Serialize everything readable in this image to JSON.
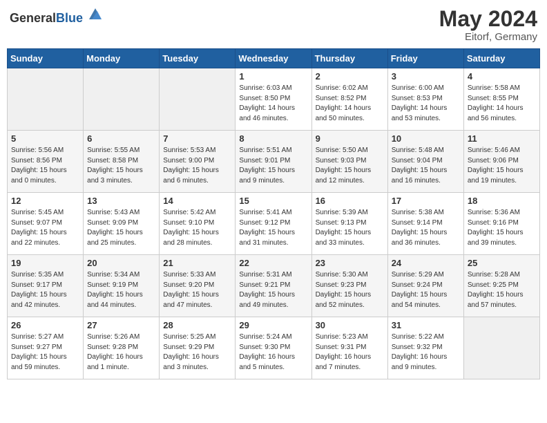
{
  "header": {
    "logo_general": "General",
    "logo_blue": "Blue",
    "month_year": "May 2024",
    "location": "Eitorf, Germany"
  },
  "weekdays": [
    "Sunday",
    "Monday",
    "Tuesday",
    "Wednesday",
    "Thursday",
    "Friday",
    "Saturday"
  ],
  "weeks": [
    [
      {
        "day": "",
        "info": ""
      },
      {
        "day": "",
        "info": ""
      },
      {
        "day": "",
        "info": ""
      },
      {
        "day": "1",
        "info": "Sunrise: 6:03 AM\nSunset: 8:50 PM\nDaylight: 14 hours\nand 46 minutes."
      },
      {
        "day": "2",
        "info": "Sunrise: 6:02 AM\nSunset: 8:52 PM\nDaylight: 14 hours\nand 50 minutes."
      },
      {
        "day": "3",
        "info": "Sunrise: 6:00 AM\nSunset: 8:53 PM\nDaylight: 14 hours\nand 53 minutes."
      },
      {
        "day": "4",
        "info": "Sunrise: 5:58 AM\nSunset: 8:55 PM\nDaylight: 14 hours\nand 56 minutes."
      }
    ],
    [
      {
        "day": "5",
        "info": "Sunrise: 5:56 AM\nSunset: 8:56 PM\nDaylight: 15 hours\nand 0 minutes."
      },
      {
        "day": "6",
        "info": "Sunrise: 5:55 AM\nSunset: 8:58 PM\nDaylight: 15 hours\nand 3 minutes."
      },
      {
        "day": "7",
        "info": "Sunrise: 5:53 AM\nSunset: 9:00 PM\nDaylight: 15 hours\nand 6 minutes."
      },
      {
        "day": "8",
        "info": "Sunrise: 5:51 AM\nSunset: 9:01 PM\nDaylight: 15 hours\nand 9 minutes."
      },
      {
        "day": "9",
        "info": "Sunrise: 5:50 AM\nSunset: 9:03 PM\nDaylight: 15 hours\nand 12 minutes."
      },
      {
        "day": "10",
        "info": "Sunrise: 5:48 AM\nSunset: 9:04 PM\nDaylight: 15 hours\nand 16 minutes."
      },
      {
        "day": "11",
        "info": "Sunrise: 5:46 AM\nSunset: 9:06 PM\nDaylight: 15 hours\nand 19 minutes."
      }
    ],
    [
      {
        "day": "12",
        "info": "Sunrise: 5:45 AM\nSunset: 9:07 PM\nDaylight: 15 hours\nand 22 minutes."
      },
      {
        "day": "13",
        "info": "Sunrise: 5:43 AM\nSunset: 9:09 PM\nDaylight: 15 hours\nand 25 minutes."
      },
      {
        "day": "14",
        "info": "Sunrise: 5:42 AM\nSunset: 9:10 PM\nDaylight: 15 hours\nand 28 minutes."
      },
      {
        "day": "15",
        "info": "Sunrise: 5:41 AM\nSunset: 9:12 PM\nDaylight: 15 hours\nand 31 minutes."
      },
      {
        "day": "16",
        "info": "Sunrise: 5:39 AM\nSunset: 9:13 PM\nDaylight: 15 hours\nand 33 minutes."
      },
      {
        "day": "17",
        "info": "Sunrise: 5:38 AM\nSunset: 9:14 PM\nDaylight: 15 hours\nand 36 minutes."
      },
      {
        "day": "18",
        "info": "Sunrise: 5:36 AM\nSunset: 9:16 PM\nDaylight: 15 hours\nand 39 minutes."
      }
    ],
    [
      {
        "day": "19",
        "info": "Sunrise: 5:35 AM\nSunset: 9:17 PM\nDaylight: 15 hours\nand 42 minutes."
      },
      {
        "day": "20",
        "info": "Sunrise: 5:34 AM\nSunset: 9:19 PM\nDaylight: 15 hours\nand 44 minutes."
      },
      {
        "day": "21",
        "info": "Sunrise: 5:33 AM\nSunset: 9:20 PM\nDaylight: 15 hours\nand 47 minutes."
      },
      {
        "day": "22",
        "info": "Sunrise: 5:31 AM\nSunset: 9:21 PM\nDaylight: 15 hours\nand 49 minutes."
      },
      {
        "day": "23",
        "info": "Sunrise: 5:30 AM\nSunset: 9:23 PM\nDaylight: 15 hours\nand 52 minutes."
      },
      {
        "day": "24",
        "info": "Sunrise: 5:29 AM\nSunset: 9:24 PM\nDaylight: 15 hours\nand 54 minutes."
      },
      {
        "day": "25",
        "info": "Sunrise: 5:28 AM\nSunset: 9:25 PM\nDaylight: 15 hours\nand 57 minutes."
      }
    ],
    [
      {
        "day": "26",
        "info": "Sunrise: 5:27 AM\nSunset: 9:27 PM\nDaylight: 15 hours\nand 59 minutes."
      },
      {
        "day": "27",
        "info": "Sunrise: 5:26 AM\nSunset: 9:28 PM\nDaylight: 16 hours\nand 1 minute."
      },
      {
        "day": "28",
        "info": "Sunrise: 5:25 AM\nSunset: 9:29 PM\nDaylight: 16 hours\nand 3 minutes."
      },
      {
        "day": "29",
        "info": "Sunrise: 5:24 AM\nSunset: 9:30 PM\nDaylight: 16 hours\nand 5 minutes."
      },
      {
        "day": "30",
        "info": "Sunrise: 5:23 AM\nSunset: 9:31 PM\nDaylight: 16 hours\nand 7 minutes."
      },
      {
        "day": "31",
        "info": "Sunrise: 5:22 AM\nSunset: 9:32 PM\nDaylight: 16 hours\nand 9 minutes."
      },
      {
        "day": "",
        "info": ""
      }
    ]
  ]
}
